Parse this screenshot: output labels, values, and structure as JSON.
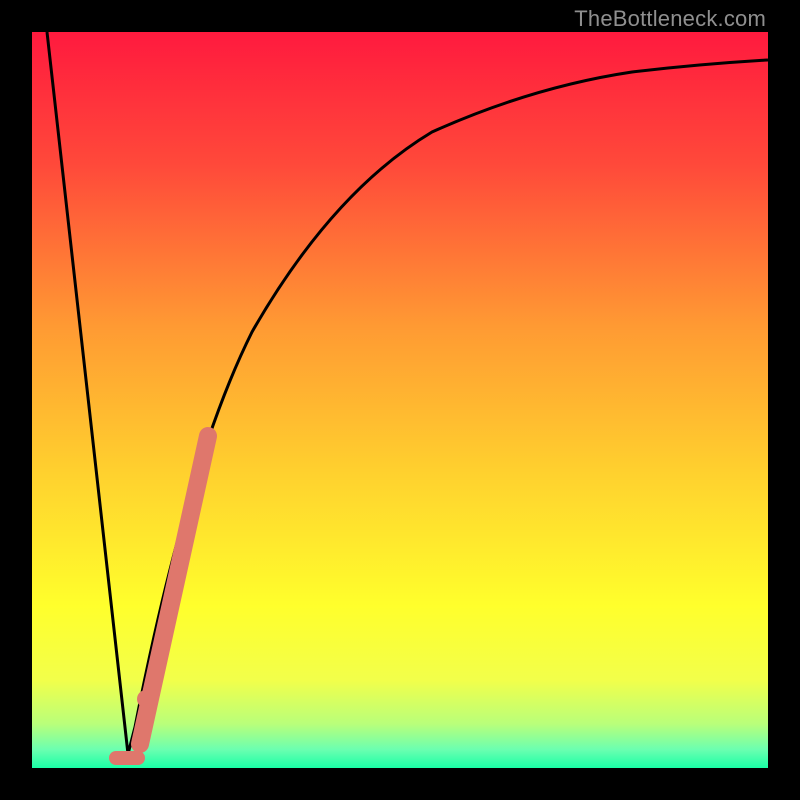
{
  "watermark": "TheBottleneck.com",
  "chart_data": {
    "type": "line",
    "title": "",
    "xlabel": "",
    "ylabel": "",
    "xlim": [
      0,
      100
    ],
    "ylim": [
      0,
      100
    ],
    "grid": false,
    "legend": false,
    "background": {
      "gradient_vertical": [
        {
          "stop": 0.0,
          "color": "#ff1a3e"
        },
        {
          "stop": 0.18,
          "color": "#ff493a"
        },
        {
          "stop": 0.4,
          "color": "#ff9a33"
        },
        {
          "stop": 0.6,
          "color": "#ffd12e"
        },
        {
          "stop": 0.78,
          "color": "#ffff2c"
        },
        {
          "stop": 0.88,
          "color": "#f2ff4a"
        },
        {
          "stop": 0.94,
          "color": "#b9ff7a"
        },
        {
          "stop": 0.975,
          "color": "#6bffb0"
        },
        {
          "stop": 1.0,
          "color": "#1affa6"
        }
      ]
    },
    "series": [
      {
        "name": "bottleneck-curve",
        "stroke": "#000000",
        "x": [
          2,
          4,
          6,
          8,
          10,
          12,
          13,
          14,
          16,
          18,
          20,
          22,
          25,
          28,
          32,
          36,
          40,
          45,
          50,
          55,
          60,
          66,
          72,
          78,
          85,
          92,
          100
        ],
        "y": [
          100,
          86,
          72,
          58,
          44,
          30,
          16,
          2,
          14,
          30,
          44,
          55,
          64,
          71,
          77,
          81,
          84,
          87,
          89,
          90.5,
          92,
          93,
          94,
          94.5,
          95,
          95.5,
          96
        ],
        "note": "y is plotted from top=100 to bottom=0 (high value = near top of plot)"
      },
      {
        "name": "highlight-segment",
        "stroke": "#e0786d",
        "stroke_width": 10,
        "x": [
          14.5,
          23.5
        ],
        "y": [
          3,
          57
        ]
      },
      {
        "name": "highlight-dot",
        "stroke": "#e0786d",
        "type_hint": "scatter",
        "x": [
          15.2
        ],
        "y": [
          9
        ]
      },
      {
        "name": "minimum-dash",
        "stroke": "#e0786d",
        "stroke_width": 8,
        "x": [
          11.5,
          14.2
        ],
        "y": [
          1.3,
          1.3
        ]
      }
    ]
  }
}
